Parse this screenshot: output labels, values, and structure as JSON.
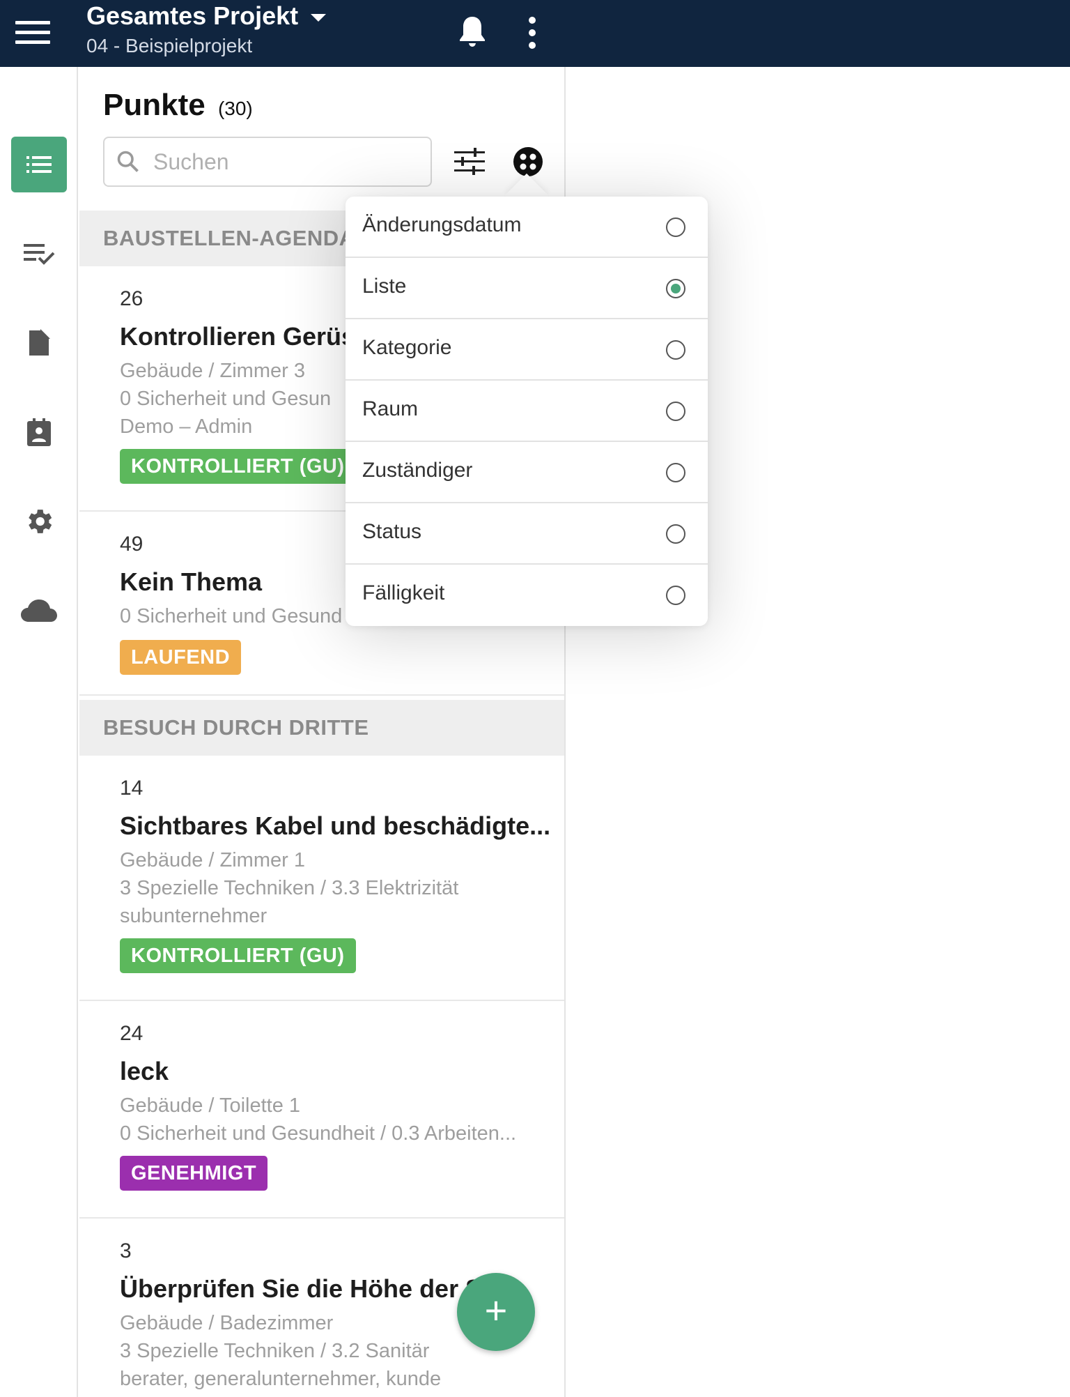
{
  "header": {
    "title": "Gesamtes Projekt",
    "subtitle": "04 - Beispielprojekt",
    "menu_icon": "hamburger-icon",
    "notification_icon": "bell-icon",
    "more_icon": "more-vertical-icon"
  },
  "rail": {
    "items": [
      {
        "icon": "list-icon",
        "active": true
      },
      {
        "icon": "checklist-icon",
        "active": false
      },
      {
        "icon": "document-icon",
        "active": false
      },
      {
        "icon": "contact-clipboard-icon",
        "active": false
      },
      {
        "icon": "gear-icon",
        "active": false
      },
      {
        "icon": "cloud-icon",
        "active": false
      }
    ],
    "active_color": "#4aa67c"
  },
  "list": {
    "title": "Punkte",
    "count": "(30)",
    "search_placeholder": "Suchen",
    "filter_icon": "sliders-icon",
    "group_icon": "group-dots-icon",
    "sections": [
      {
        "label": "BAUSTELLEN-AGENDA",
        "items": [
          {
            "number": "26",
            "title": "Kontrollieren Gerüs",
            "lines": [
              "Gebäude / Zimmer 3",
              "0 Sicherheit und Gesun",
              "Demo – Admin"
            ],
            "status": "KONTROLLIERT (GU)",
            "status_color": "#5cb85c"
          },
          {
            "number": "49",
            "title": "Kein Thema",
            "lines": [
              "0 Sicherheit und Gesund"
            ],
            "status": "LAUFEND",
            "status_color": "#f0ad4e"
          }
        ]
      },
      {
        "label": "BESUCH DURCH DRITTE",
        "items": [
          {
            "number": "14",
            "title": "Sichtbares Kabel und beschädigte...",
            "lines": [
              "Gebäude / Zimmer 1",
              "3 Spezielle Techniken / 3.3 Elektrizität",
              "subunternehmer"
            ],
            "status": "KONTROLLIERT (GU)",
            "status_color": "#5cb85c"
          },
          {
            "number": "24",
            "title": "leck",
            "lines": [
              "Gebäude / Toilette 1",
              "0 Sicherheit und Gesundheit / 0.3 Arbeiten..."
            ],
            "status": "GENEHMIGT",
            "status_color": "#9b2fae"
          },
          {
            "number": "3",
            "title": "Überprüfen Sie die Höhe der S",
            "lines": [
              "Gebäude / Badezimmer",
              "3 Spezielle Techniken / 3.2 Sanitär",
              "berater, generalunternehmer, kunde"
            ]
          }
        ]
      }
    ],
    "fab_label": "+"
  },
  "grouping_menu": {
    "options": [
      {
        "label": "Änderungsdatum",
        "selected": false
      },
      {
        "label": "Liste",
        "selected": true
      },
      {
        "label": "Kategorie",
        "selected": false
      },
      {
        "label": "Raum",
        "selected": false
      },
      {
        "label": "Zuständiger",
        "selected": false
      },
      {
        "label": "Status",
        "selected": false
      },
      {
        "label": "Fälligkeit",
        "selected": false
      }
    ]
  }
}
